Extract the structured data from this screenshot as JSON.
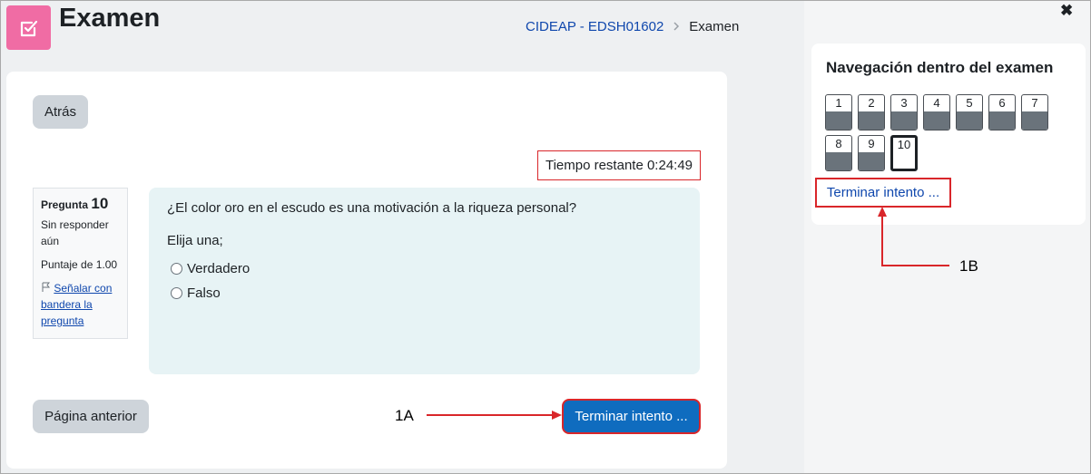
{
  "header": {
    "title": "Examen",
    "icon": "quiz-icon",
    "accent": "#f06ca4"
  },
  "breadcrumb": {
    "course": "CIDEAP - EDSH01602",
    "current": "Examen",
    "separator": ">"
  },
  "main": {
    "back_label": "Atrás",
    "timer": "Tiempo restante 0:24:49",
    "question_info": {
      "label": "Pregunta",
      "number": "10",
      "status": "Sin responder aún",
      "grade": "Puntaje de 1.00",
      "flag_label": "Señalar con bandera la pregunta"
    },
    "question": {
      "text": "¿El color oro en el escudo es una motivación a la riqueza personal?",
      "prompt": "Elija una;",
      "options": [
        "Verdadero",
        "Falso"
      ]
    },
    "prev_label": "Página anterior",
    "finish_label": "Terminar intento ..."
  },
  "annotations": {
    "a": "1A",
    "b": "1B"
  },
  "drawer": {
    "close": "✖",
    "nav_title": "Navegación dentro del examen",
    "questions": [
      "1",
      "2",
      "3",
      "4",
      "5",
      "6",
      "7",
      "8",
      "9",
      "10"
    ],
    "current": "10",
    "finish_link": "Terminar intento ..."
  },
  "colors": {
    "primary": "#0f6cbf",
    "link": "#0f47ad",
    "highlight": "#d9262a",
    "question_bg": "#e7f3f5"
  }
}
